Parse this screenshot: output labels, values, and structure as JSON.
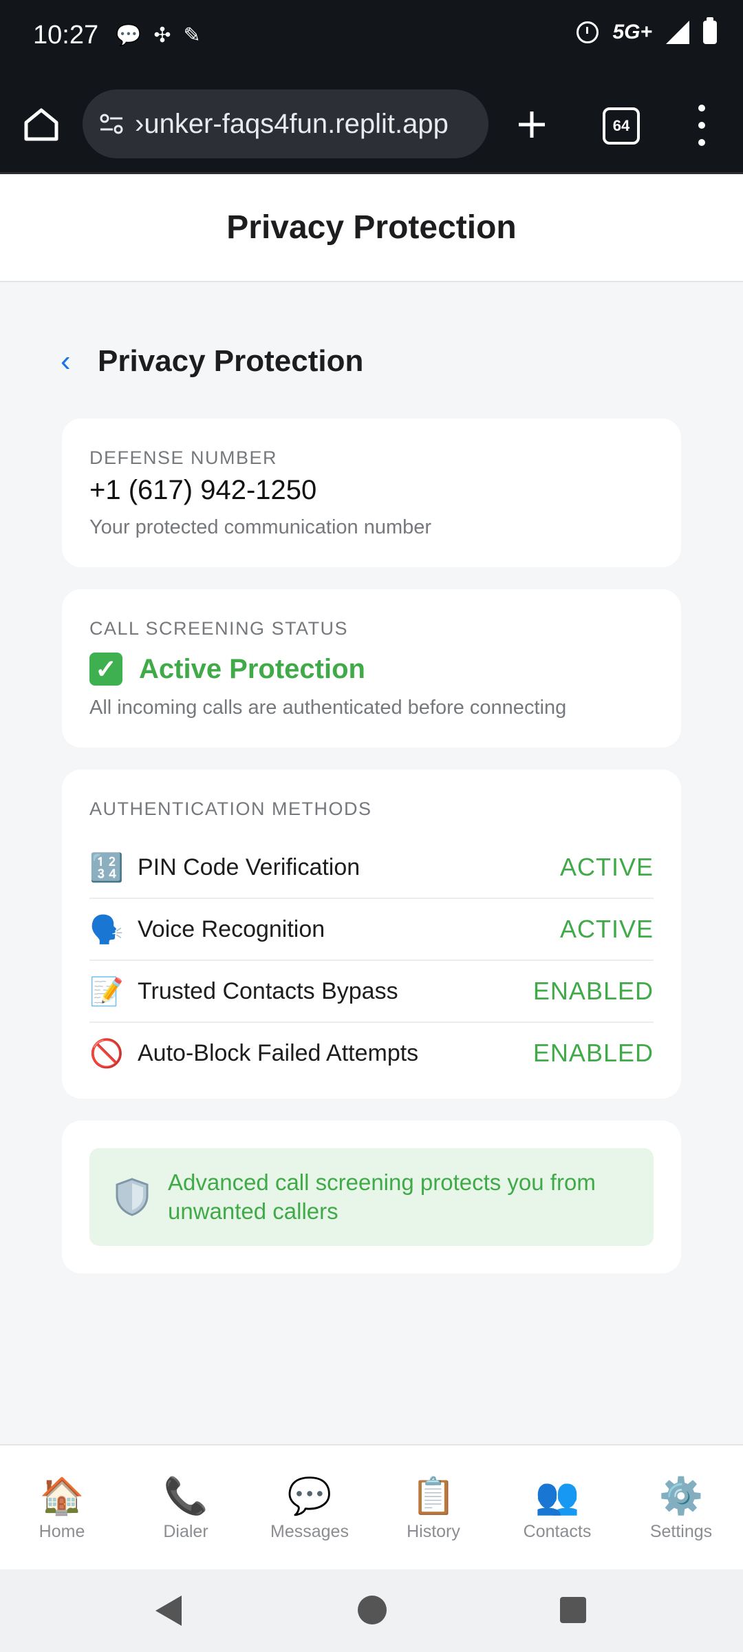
{
  "status_bar": {
    "time": "10:27",
    "network": "5G+"
  },
  "browser": {
    "url": "›unker-faqs4fun.replit.app",
    "tab_count": "64"
  },
  "header": {
    "title": "Privacy Protection"
  },
  "page": {
    "title": "Privacy Protection",
    "back_icon": "‹"
  },
  "defense_card": {
    "label": "DEFENSE NUMBER",
    "number": "+1 (617) 942-1250",
    "description": "Your protected communication number"
  },
  "screening_card": {
    "label": "CALL SCREENING STATUS",
    "status": "Active Protection",
    "description": "All incoming calls are authenticated before connecting"
  },
  "auth_card": {
    "label": "AUTHENTICATION METHODS",
    "methods": [
      {
        "icon": "🔢",
        "label": "PIN Code Verification",
        "status": "ACTIVE"
      },
      {
        "icon": "🗣️",
        "label": "Voice Recognition",
        "status": "ACTIVE"
      },
      {
        "icon": "📝",
        "label": "Trusted Contacts Bypass",
        "status": "ENABLED"
      },
      {
        "icon": "🚫",
        "label": "Auto-Block Failed Attempts",
        "status": "ENABLED"
      }
    ]
  },
  "info_card": {
    "text": "Advanced call screening protects you from unwanted callers"
  },
  "bottom_nav": [
    {
      "icon": "🏠",
      "label": "Home"
    },
    {
      "icon": "📞",
      "label": "Dialer"
    },
    {
      "icon": "💬",
      "label": "Messages"
    },
    {
      "icon": "📋",
      "label": "History"
    },
    {
      "icon": "👥",
      "label": "Contacts"
    },
    {
      "icon": "⚙️",
      "label": "Settings"
    }
  ],
  "colors": {
    "accent_green": "#3faa47",
    "link_blue": "#1a73e8",
    "browser_bg": "#12161b"
  }
}
